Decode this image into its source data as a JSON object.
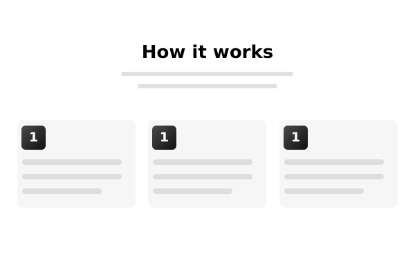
{
  "header": {
    "title": "How it works"
  },
  "steps": [
    {
      "number": "1"
    },
    {
      "number": "1"
    },
    {
      "number": "1"
    }
  ]
}
